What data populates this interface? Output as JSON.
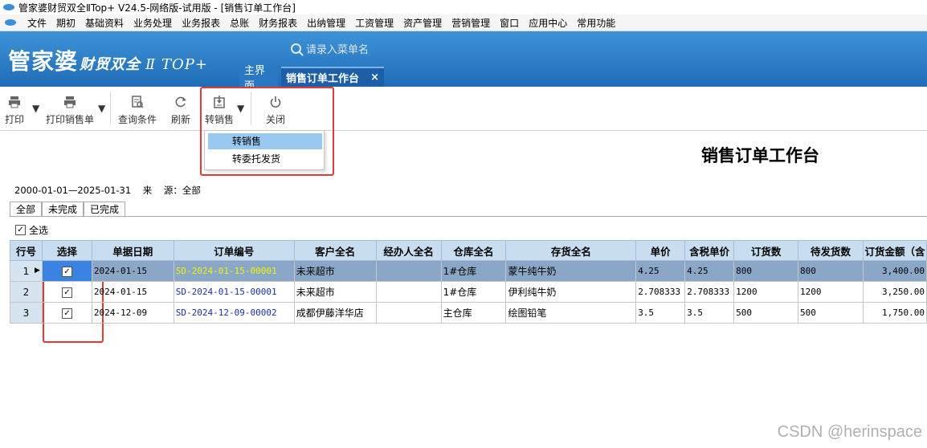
{
  "window": {
    "title": "管家婆财贸双全ⅡTop+ V24.5-网络版-试用版 - [销售订单工作台]"
  },
  "menu": [
    "文件",
    "期初",
    "基础资料",
    "业务处理",
    "业务报表",
    "总账",
    "财务报表",
    "出纳管理",
    "工资管理",
    "资产管理",
    "营销管理",
    "窗口",
    "应用中心",
    "常用功能"
  ],
  "banner": {
    "brand_main": "管家婆",
    "brand_sub": "财贸双全",
    "brand_version": "Ⅱ TOP+",
    "search_placeholder": "请录入菜单名"
  },
  "tabs": {
    "home": "主界面",
    "active": "销售订单工作台",
    "close": "×"
  },
  "toolbar": {
    "print": "打印",
    "print_order": "打印销售单",
    "query": "查询条件",
    "refresh": "刷新",
    "transfer": "转销售",
    "close": "关闭"
  },
  "dropdown": {
    "item1": "转销售",
    "item2": "转委托发货"
  },
  "page": {
    "title": "销售订单工作台"
  },
  "filter": {
    "date_range": "2000-01-01—2025-01-31",
    "source_label": "来    源：",
    "source_value": "全部"
  },
  "status_tabs": [
    "全部",
    "未完成",
    "已完成"
  ],
  "select_all": {
    "label": "全选",
    "checked": true
  },
  "table": {
    "headers": [
      "行号",
      "选择",
      "单据日期",
      "订单编号",
      "客户全名",
      "经办人全名",
      "仓库全名",
      "存货全名",
      "单价",
      "含税单价",
      "订货数",
      "待发货数",
      "订货金额（含"
    ],
    "rows": [
      {
        "no": "1",
        "checked": true,
        "date": "2024-01-15",
        "code": "SD-2024-01-15-00001",
        "customer": "未来超市",
        "handler": "",
        "warehouse": "1#仓库",
        "item": "蒙牛纯牛奶",
        "price": "4.25",
        "tax_price": "4.25",
        "qty": "800",
        "pending": "800",
        "amount": "3,400.00"
      },
      {
        "no": "2",
        "checked": true,
        "date": "2024-01-15",
        "code": "SD-2024-01-15-00001",
        "customer": "未来超市",
        "handler": "",
        "warehouse": "1#仓库",
        "item": "伊利纯牛奶",
        "price": "2.708333",
        "tax_price": "2.708333",
        "qty": "1200",
        "pending": "1200",
        "amount": "3,250.00"
      },
      {
        "no": "3",
        "checked": true,
        "date": "2024-12-09",
        "code": "SD-2024-12-09-00002",
        "customer": "成都伊藤洋华店",
        "handler": "",
        "warehouse": "主仓库",
        "item": "绘图铅笔",
        "price": "3.5",
        "tax_price": "3.5",
        "qty": "500",
        "pending": "500",
        "amount": "1,750.00"
      }
    ]
  },
  "watermark": "CSDN @herinspace",
  "colors": {
    "banner": "#2b7fcb",
    "header_bg": "#c9ddf0",
    "selected_row": "#8aa7c8",
    "highlight": "#e53935"
  }
}
